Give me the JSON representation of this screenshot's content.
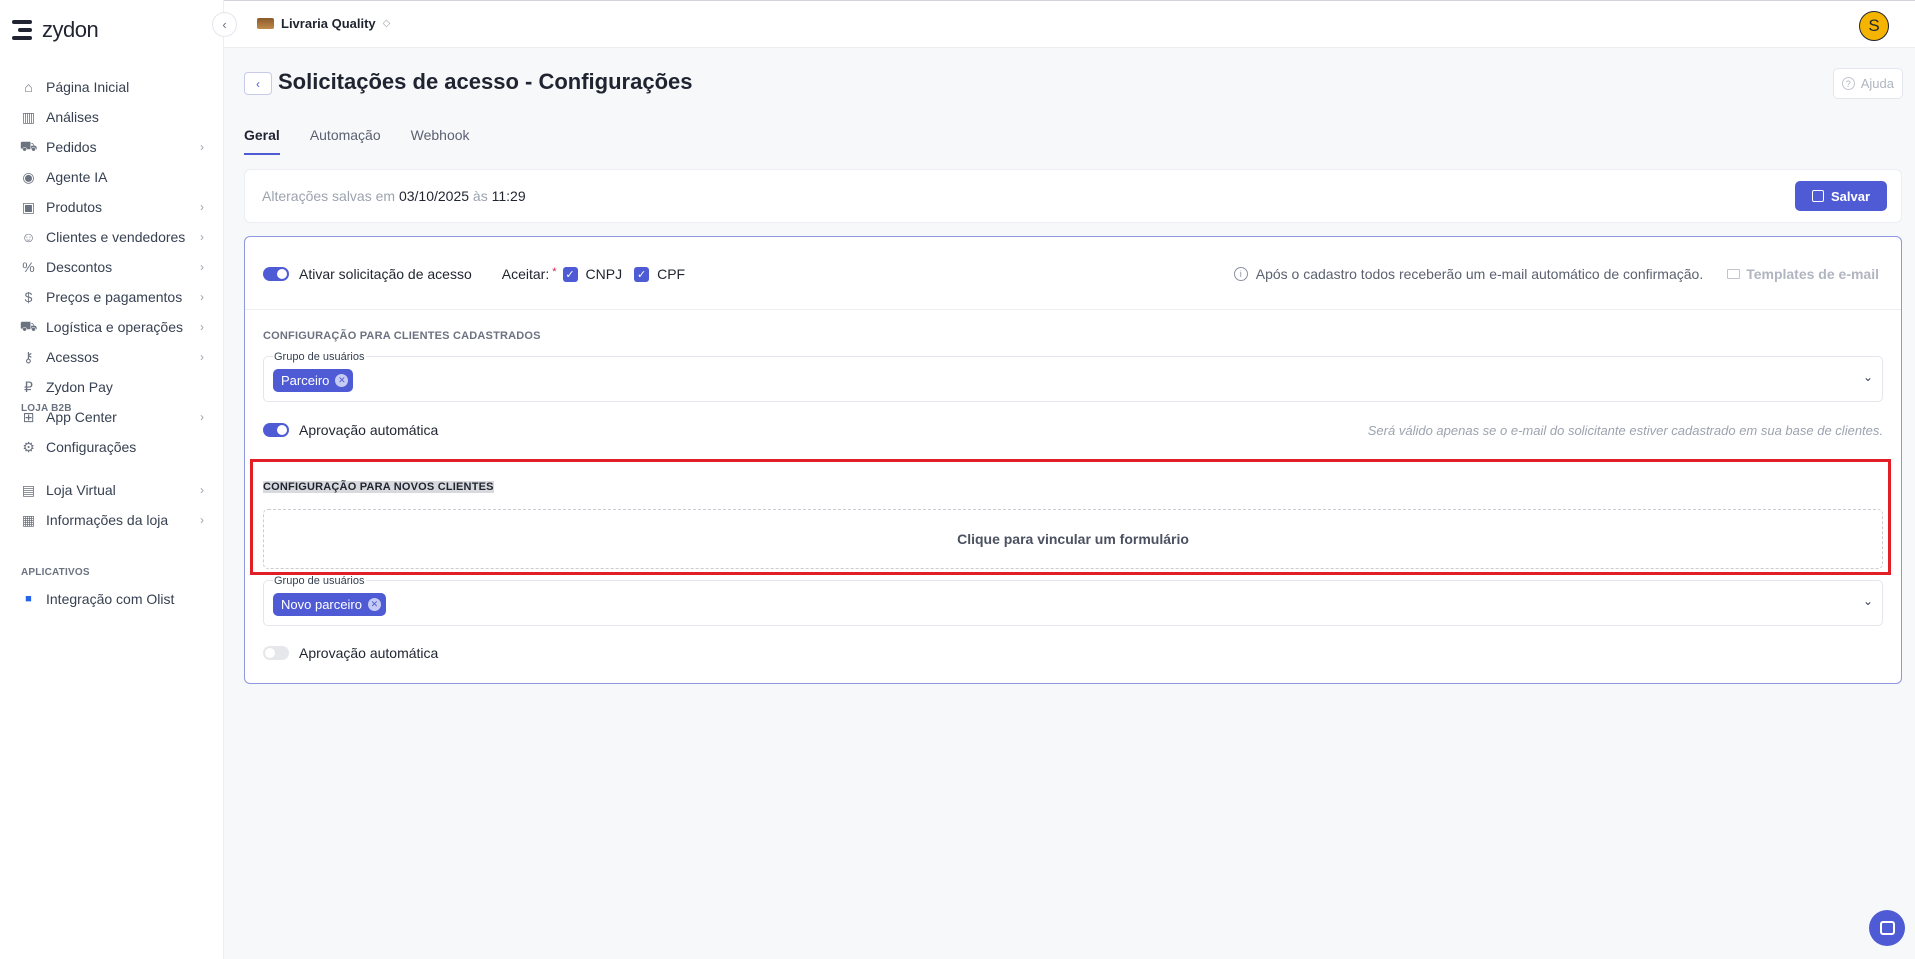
{
  "brand": {
    "name": "zydon"
  },
  "store": {
    "name": "Livraria Quality"
  },
  "user": {
    "initial": "S"
  },
  "sidebar": {
    "items": [
      {
        "label": "Página Inicial",
        "icon": "home-icon",
        "chevron": false
      },
      {
        "label": "Análises",
        "icon": "bar-chart-icon",
        "chevron": false
      },
      {
        "label": "Pedidos",
        "icon": "cart-icon",
        "chevron": true
      },
      {
        "label": "Agente IA",
        "icon": "ai-agent-icon",
        "chevron": false
      },
      {
        "label": "Produtos",
        "icon": "box-icon",
        "chevron": true
      },
      {
        "label": "Clientes e vendedores",
        "icon": "users-icon",
        "chevron": true
      },
      {
        "label": "Descontos",
        "icon": "discount-icon",
        "chevron": true
      },
      {
        "label": "Preços e pagamentos",
        "icon": "dollar-icon",
        "chevron": true
      },
      {
        "label": "Logística e operações",
        "icon": "truck-icon",
        "chevron": true
      },
      {
        "label": "Acessos",
        "icon": "key-icon",
        "chevron": true
      },
      {
        "label": "Zydon Pay",
        "icon": "pay-icon",
        "chevron": false
      },
      {
        "label": "App Center",
        "icon": "apps-icon",
        "chevron": true
      },
      {
        "label": "Configurações",
        "icon": "gear-icon",
        "chevron": false
      }
    ],
    "section_b2b": "LOJA B2B",
    "b2b_items": [
      {
        "label": "Loja Virtual",
        "icon": "store-icon",
        "chevron": true
      },
      {
        "label": "Informações da loja",
        "icon": "info-card-icon",
        "chevron": true
      }
    ],
    "section_apps": "APLICATIVOS",
    "app_items": [
      {
        "label": "Integração com Olist",
        "icon": "olist-icon",
        "chevron": false
      }
    ]
  },
  "page": {
    "title_prefix": "Solicitações de acesso - ",
    "title_bold": "Configurações",
    "help_label": "Ajuda"
  },
  "tabs": [
    "Geral",
    "Automação",
    "Webhook"
  ],
  "saved": {
    "prefix": "Alterações salvas em ",
    "date": "03/10/2025",
    "middle": " às ",
    "time": "11:29",
    "save_label": "Salvar"
  },
  "config": {
    "enable_label": "Ativar solicitação de acesso",
    "accept_label": "Aceitar:",
    "required_mark": "*",
    "cnpj_label": "CNPJ",
    "cpf_label": "CPF",
    "info_text": "Após o cadastro todos receberão um e-mail automático de confirmação.",
    "templates_label": "Templates de e-mail",
    "registered": {
      "title": "CONFIGURAÇÃO PARA CLIENTES CADASTRADOS",
      "group_label": "Grupo de usuários",
      "chip": "Parceiro",
      "auto_label": "Aprovação automática",
      "auto_on": true,
      "hint": "Será válido apenas se o e-mail do solicitante estiver cadastrado em sua base de clientes."
    },
    "new_clients": {
      "title": "CONFIGURAÇÃO PARA NOVOS CLIENTES",
      "link_form": "Clique para vincular um formulário",
      "group_label": "Grupo de usuários",
      "chip": "Novo parceiro",
      "auto_label": "Aprovação automática",
      "auto_on": false
    }
  },
  "colors": {
    "accent": "#4f5bd5",
    "highlight": "#e21f26"
  }
}
